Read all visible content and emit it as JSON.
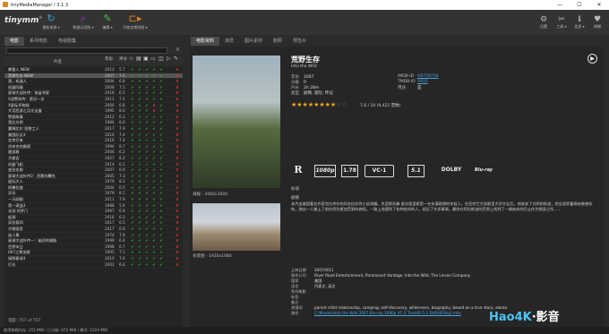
{
  "window": {
    "title": "tinyMediaManager / 3.1.3",
    "min": "—",
    "max": "☐",
    "close": "✕"
  },
  "toolbar": {
    "logo": "tinymm",
    "logo_tm": "®",
    "buttons": [
      {
        "label": "更新来源 ▾",
        "icon": "refresh-icon",
        "color": "#33a3d8",
        "glyph": "↻"
      },
      {
        "label": "数据元刮削 ▾",
        "icon": "search-icon",
        "color": "#a03cc8",
        "glyph": "⌕"
      },
      {
        "label": "编辑 ▾",
        "icon": "edit-icon",
        "color": "#4cbd4c",
        "glyph": "✎"
      },
      {
        "label": "开始定期刮削 ▾",
        "icon": "media-icon",
        "color": "#e0801e",
        "glyph": "⊏▸"
      }
    ],
    "right": [
      {
        "label": "设置",
        "glyph": "⚙"
      },
      {
        "label": "工具 ▾",
        "glyph": "✂"
      },
      {
        "label": "信息 ▾",
        "glyph": "ℹ"
      },
      {
        "label": "捐赠",
        "glyph": "♥"
      }
    ]
  },
  "lefttabs": [
    "电影",
    "系列电影",
    "电视剧集"
  ],
  "detailtabs": [
    "电影资料",
    "演员",
    "图片素材",
    "剧照",
    "预告片"
  ],
  "filter": {
    "placeholder": "",
    "clear": "✕"
  },
  "table": {
    "header": {
      "title": "片名",
      "year": "年份",
      "rating": "评分"
    },
    "rows": [
      {
        "title": "誊誓人 NEW",
        "year": "2013",
        "rating": "5.7",
        "flags": "ckkkkk-x"
      },
      {
        "title": "荒野生存 NEW",
        "year": "2007",
        "rating": "7.6",
        "flags": "ckkkkk-x",
        "sel": true
      },
      {
        "title": "我，机器人",
        "year": "2004",
        "rating": "6.8",
        "flags": "ckkkkk-x"
      },
      {
        "title": "机器同情",
        "year": "2008",
        "rating": "7.5",
        "flags": "ckkkkk-x"
      },
      {
        "title": "星球大战外传：侠盗寻星",
        "year": "2016",
        "rating": "6.5",
        "flags": "ckkkkk-x"
      },
      {
        "title": "X战警前传：第另一次",
        "year": "2011",
        "rating": "7.4",
        "flags": "ckkkkk-x"
      },
      {
        "title": "X星际坏物秘",
        "year": "2006",
        "rating": "6.8",
        "flags": "ckkkxk-x"
      },
      {
        "title": "大话西游之月光宝盒",
        "year": "1995",
        "rating": "8.0",
        "flags": "ckkkxk-x"
      },
      {
        "title": "警察故事",
        "year": "2012",
        "rating": "6.3",
        "flags": "ckkkkk-x"
      },
      {
        "title": "我比光明",
        "year": "1984",
        "rating": "8.0",
        "flags": "ckkkkk-x"
      },
      {
        "title": "霍姆比尔 怪兽工人",
        "year": "2017",
        "rating": "7.9",
        "flags": "ckkkkk-x"
      },
      {
        "title": "美国队长3",
        "year": "2016",
        "rating": "7.4",
        "flags": "ckkkkk-x"
      },
      {
        "title": "北京仔来",
        "year": "2016",
        "rating": "7.4",
        "flags": "ckkkkk-x"
      },
      {
        "title": "肖申克的救赎",
        "year": "1994",
        "rating": "8.7",
        "flags": "ckkkkk-x"
      },
      {
        "title": "遨游救",
        "year": "2006",
        "rating": "6.2",
        "flags": "ckkkkk-x"
      },
      {
        "title": "大都会",
        "year": "1927",
        "rating": "8.2",
        "flags": "ckkkkk-x"
      },
      {
        "title": "机器飞机",
        "year": "2014",
        "rating": "6.1",
        "flags": "ckkkkk-x"
      },
      {
        "title": "变形金刚",
        "year": "2007",
        "rating": "6.9",
        "flags": "ckkkkk-x"
      },
      {
        "title": "星球大战外传2：西蒙的覆仇",
        "year": "2005",
        "rating": "7.3",
        "flags": "ckkkkk-x"
      },
      {
        "title": "星际大人",
        "year": "1979",
        "rating": "8.1",
        "flags": "ckkkkk-x"
      },
      {
        "title": "阿撒拉旋",
        "year": "2004",
        "rating": "6.5",
        "flags": "ckkkkk-x"
      },
      {
        "title": "异形",
        "year": "1979",
        "rating": "8.1",
        "flags": "ckkkkk-x"
      },
      {
        "title": "一天刚刚",
        "year": "2011",
        "rating": "7.9",
        "flags": "ckkkkk-x"
      },
      {
        "title": "第一滴血3",
        "year": "1988",
        "rating": "5.9",
        "flags": "ckkkkk-x"
      },
      {
        "title": "永别 所罗门",
        "year": "1997",
        "rating": "6.9",
        "flags": "ckkkkk-x"
      },
      {
        "title": "起源",
        "year": "2016",
        "rating": "6.2",
        "flags": "ckkkkk-x"
      },
      {
        "title": "异形第四",
        "year": "2017",
        "rating": "6.5",
        "flags": "ckkkkk-x"
      },
      {
        "title": "大眼宿舍",
        "year": "2017",
        "rating": "6.8",
        "flags": "ckkkkk-x"
      },
      {
        "title": "迷人舞",
        "year": "1974",
        "rating": "7.9",
        "flags": "ckkkkk-x"
      },
      {
        "title": "星球大战外传一：幽灵的威胁",
        "year": "1999",
        "rating": "6.4",
        "flags": "ckkkkk-x"
      },
      {
        "title": "世界末日",
        "year": "1998",
        "rating": "6.7",
        "flags": "ckkkkk-x"
      },
      {
        "title": "007之黄金眼",
        "year": "1995",
        "rating": "7.1",
        "flags": "ckkkkk-x"
      },
      {
        "title": "绿野星球3",
        "year": "2010",
        "rating": "7.6",
        "flags": "ckkkkk-x"
      },
      {
        "title": "灯光",
        "year": "2002",
        "rating": "6.4",
        "flags": "ckkkkk-x"
      }
    ],
    "count_label": "电影: 757 of 757"
  },
  "detail": {
    "title": "荒野生存",
    "original": "Into the Wild",
    "info": [
      [
        "年份",
        "2007"
      ],
      [
        "分级",
        "R"
      ],
      [
        "片长",
        "2h 28m"
      ],
      [
        "类型",
        "剧情, 冒险, 传记"
      ]
    ],
    "ids": [
      [
        "IMDB-ID",
        "tt0758758"
      ],
      [
        "TMDB-ID",
        "5915"
      ],
      [
        "用途",
        "是"
      ]
    ],
    "rating": "7.6 / 10 (9,421 票数)",
    "stars": 8,
    "badges": [
      "R",
      "1080p",
      "1.78",
      "VC-1",
      "5.1",
      "DOLBY",
      "Blu-ray"
    ],
    "tagline_label": "标语",
    "plot_label": "剧情",
    "plot": "本片由美国著名作家克拉考尔的同名纪实性小说改编。克里斯托弗·麦坎德里斯是一名充满理想的年轻人，在亚特兰大埃默里大学毕业后，他放弃了光明的前途，把全部积蓄捐给慈善机构，独自一人踏上了前往阿拉斯加荒野的旅程。一路上他遇到了各种各样的人，经历了许多事情，最终在阿拉斯加的荒原上找到了一辆废弃的巴士作为栖身之所……",
    "poster_caption": "海报 - 2000x3000",
    "fanart_caption": "背景图 - 1920x1080",
    "meta": [
      [
        "上映日期",
        "2007/9/11"
      ],
      [
        "制作公司",
        "River Road Entertainment, Paramount Vantage, Into the Wild, The Linson Company"
      ],
      [
        "国家",
        "美国"
      ],
      [
        "语言",
        "丹麦文, 英文"
      ],
      [
        "系列电影",
        ""
      ],
      [
        "标签",
        ""
      ],
      [
        "备注",
        ""
      ],
      [
        "关键词",
        "parent child relationship, camping, self-discovery, wilderness, biography, based on a true story, alaska"
      ],
      [
        "路径",
        "C:\\Movies\\Into the Wild 2007 Blu-ray 1080p VC-1 TrueHD 5.1 EbP[HDSky].mkv"
      ]
    ]
  },
  "status": {
    "text": "使用物理内存: 251 MiB / 已分配: 872 MiB / 最大: 1024 MiB"
  },
  "watermark": {
    "a": "Hao4K",
    "b": "·影音"
  }
}
